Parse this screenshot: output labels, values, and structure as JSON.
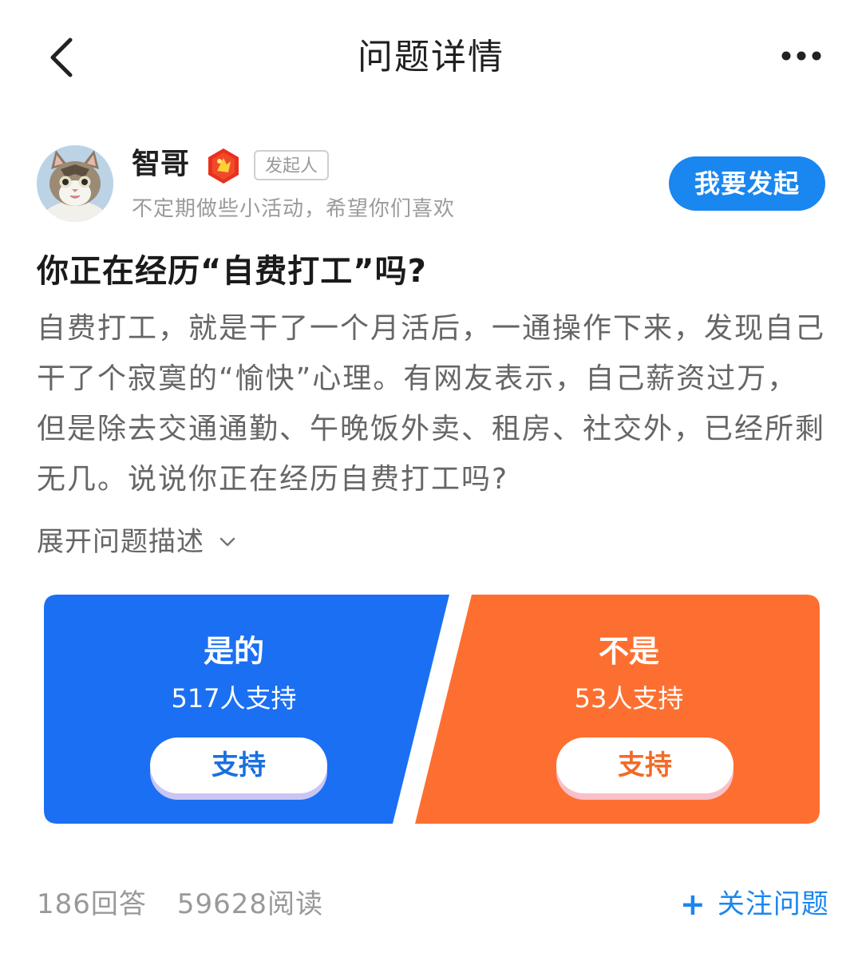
{
  "header": {
    "title": "问题详情",
    "back_icon": "chevron-left-icon",
    "more_icon": "more-dots-icon"
  },
  "author": {
    "name": "智哥",
    "role_tag": "发起人",
    "bio": "不定期做些小活动，希望你们喜欢",
    "start_button": "我要发起"
  },
  "question": {
    "title": "你正在经历“自费打工”吗?",
    "description": "自费打工，就是干了一个月活后，一通操作下来，发现自己干了个寂寞的“愉快”心理。有网友表示，自己薪资过万，但是除去交通通勤、午晚饭外卖、租房、社交外，已经所剩无几。说说你正在经历自费打工吗?",
    "expand_label": "展开问题描述"
  },
  "vote": {
    "yes": {
      "label": "是的",
      "count_text": "517人支持",
      "button": "支持",
      "color": "#1b6ff2"
    },
    "no": {
      "label": "不是",
      "count_text": "53人支持",
      "button": "支持",
      "color": "#fd6f30"
    }
  },
  "footer": {
    "answers": "186回答",
    "reads": "59628阅读",
    "follow_label": "关注问题",
    "follow_icon": "+"
  },
  "colors": {
    "accent_blue": "#1a86f0",
    "yes_blue": "#1b6ff2",
    "no_orange": "#fd6f30"
  }
}
